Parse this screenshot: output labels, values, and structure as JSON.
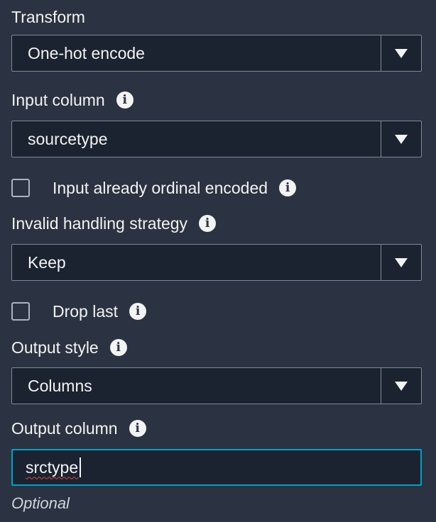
{
  "transform": {
    "label": "Transform",
    "value": "One-hot encode"
  },
  "input_column": {
    "label": "Input column",
    "value": "sourcetype",
    "info_icon": "info-icon"
  },
  "input_ordinal": {
    "label": "Input already ordinal encoded",
    "checked": false,
    "info_icon": "info-icon"
  },
  "invalid_handling": {
    "label": "Invalid handling strategy",
    "value": "Keep",
    "info_icon": "info-icon"
  },
  "drop_last": {
    "label": "Drop last",
    "checked": false,
    "info_icon": "info-icon"
  },
  "output_style": {
    "label": "Output style",
    "value": "Columns",
    "info_icon": "info-icon"
  },
  "output_column": {
    "label": "Output column",
    "value": "srctype ",
    "hint": "Optional",
    "info_icon": "info-icon"
  },
  "colors": {
    "background": "#2b3342",
    "field_background": "#1b2331",
    "border": "#7d8998",
    "focus_border": "#00a1c9",
    "text": "#f2f3f3"
  }
}
